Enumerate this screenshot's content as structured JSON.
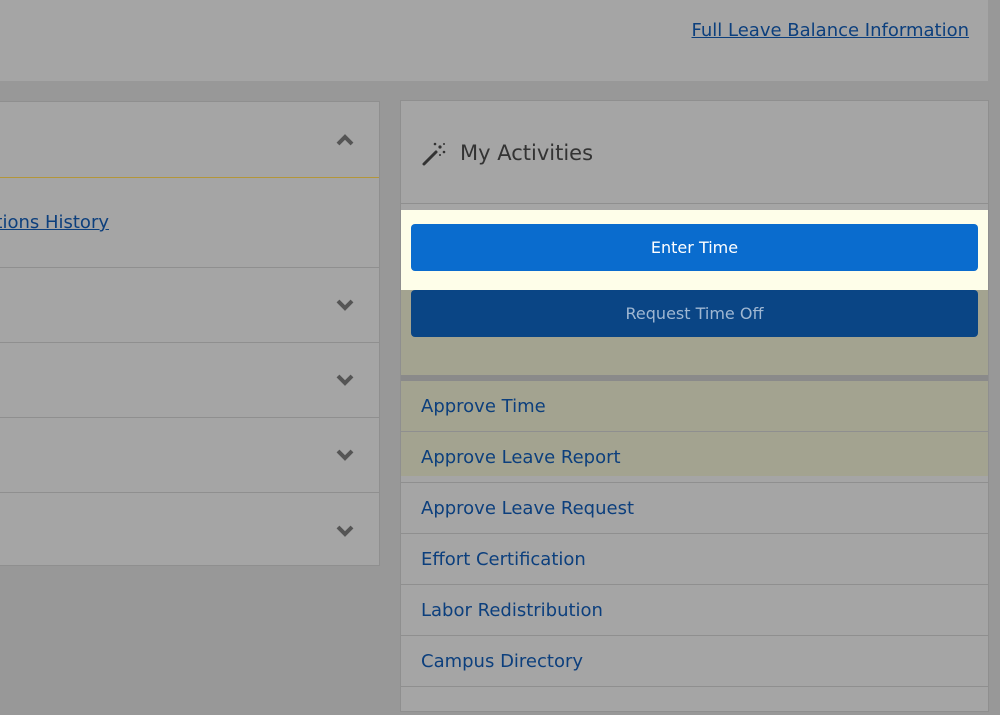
{
  "header": {
    "leave_balance_link": "Full Leave Balance Information"
  },
  "left_panel": {
    "expanded_section_link": "ctions History",
    "collapsed_rows": 4
  },
  "activities_panel": {
    "title": "My Activities",
    "title_icon": "magic-wand-icon",
    "primary_buttons": [
      {
        "label": "Enter Time",
        "highlighted": true
      },
      {
        "label": "Request Time Off",
        "highlighted": false
      }
    ],
    "links": [
      "Approve Time",
      "Approve Leave Report",
      "Approve Leave Request",
      "Effort Certification",
      "Labor Redistribution",
      "Campus Directory"
    ]
  },
  "colors": {
    "link": "#0c3f7d",
    "enter_button": "#0a6cce",
    "request_button": "#0a4585",
    "highlight": "#fefee9"
  }
}
